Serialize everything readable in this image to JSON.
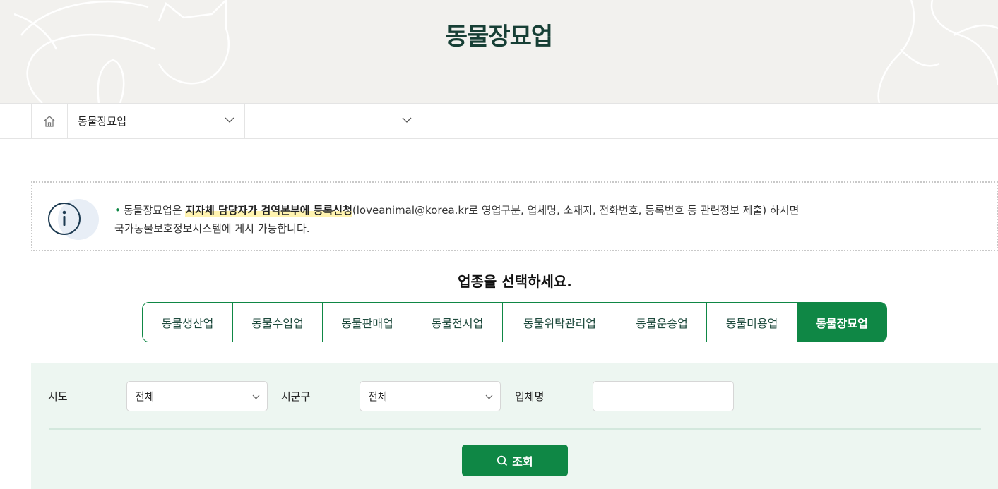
{
  "hero": {
    "title": "동물장묘업"
  },
  "breadcrumb": {
    "home_icon": "home-icon",
    "level1": "동물장묘업",
    "level2": ""
  },
  "notice": {
    "icon": "info-icon",
    "text_before": "동물장묘업은 ",
    "highlight": "지자체 담당자가 검역본부에 등록신청",
    "text_after": "(loveanimal@korea.kr로 영업구분, 업체명, 소재지, 전화번호, 등록번호 등 관련정보 제출) 하시면",
    "line2": "국가동물보호정보시스템에 게시 가능합니다."
  },
  "business_type": {
    "title": "업종을 선택하세요.",
    "tabs": [
      {
        "label": "동물생산업",
        "active": false
      },
      {
        "label": "동물수입업",
        "active": false
      },
      {
        "label": "동물판매업",
        "active": false
      },
      {
        "label": "동물전시업",
        "active": false
      },
      {
        "label": "동물위탁관리업",
        "active": false
      },
      {
        "label": "동물운송업",
        "active": false
      },
      {
        "label": "동물미용업",
        "active": false
      },
      {
        "label": "동물장묘업",
        "active": true
      }
    ]
  },
  "search": {
    "sido_label": "시도",
    "sido_value": "전체",
    "sigungu_label": "시군구",
    "sigungu_value": "전체",
    "company_label": "업체명",
    "company_value": "",
    "submit_label": "조회",
    "submit_icon": "search-icon"
  },
  "colors": {
    "primary": "#0f8745",
    "title": "#173f35",
    "hero_bg": "#f2f1ee",
    "panel_bg": "#edf6f1"
  }
}
